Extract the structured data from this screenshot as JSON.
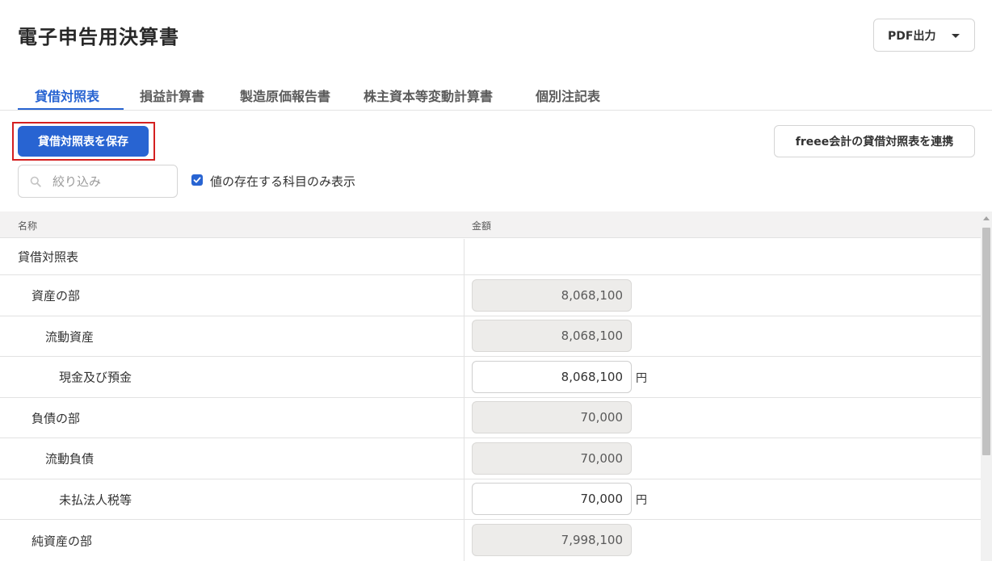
{
  "page": {
    "title": "電子申告用決算書"
  },
  "header": {
    "pdf_button_label": "PDF出力"
  },
  "tabs": [
    {
      "label": "貸借対照表",
      "active": true
    },
    {
      "label": "損益計算書",
      "active": false
    },
    {
      "label": "製造原価報告書",
      "active": false
    },
    {
      "label": "株主資本等変動計算書",
      "active": false
    },
    {
      "label": "個別注記表",
      "active": false
    }
  ],
  "toolbar": {
    "save_label": "貸借対照表を保存",
    "link_label": "freee会計の貸借対照表を連携"
  },
  "filter": {
    "search_placeholder": "絞り込み",
    "search_value": "",
    "checkbox_label": "値の存在する科目のみ表示",
    "checkbox_checked": true
  },
  "table": {
    "headers": {
      "name": "名称",
      "amount": "金額"
    },
    "rows": [
      {
        "name": "貸借対照表",
        "indent": 0,
        "amount": "",
        "editable": false,
        "unit": ""
      },
      {
        "name": "資産の部",
        "indent": 1,
        "amount": "8,068,100",
        "editable": false,
        "unit": ""
      },
      {
        "name": "流動資産",
        "indent": 2,
        "amount": "8,068,100",
        "editable": false,
        "unit": ""
      },
      {
        "name": "現金及び預金",
        "indent": 3,
        "amount": "8,068,100",
        "editable": true,
        "unit": "円"
      },
      {
        "name": "負債の部",
        "indent": 1,
        "amount": "70,000",
        "editable": false,
        "unit": ""
      },
      {
        "name": "流動負債",
        "indent": 2,
        "amount": "70,000",
        "editable": false,
        "unit": ""
      },
      {
        "name": "未払法人税等",
        "indent": 3,
        "amount": "70,000",
        "editable": true,
        "unit": "円"
      },
      {
        "name": "純資産の部",
        "indent": 1,
        "amount": "7,998,100",
        "editable": false,
        "unit": ""
      }
    ]
  },
  "colors": {
    "accent": "#2864d2",
    "highlight_border": "#d42020"
  }
}
